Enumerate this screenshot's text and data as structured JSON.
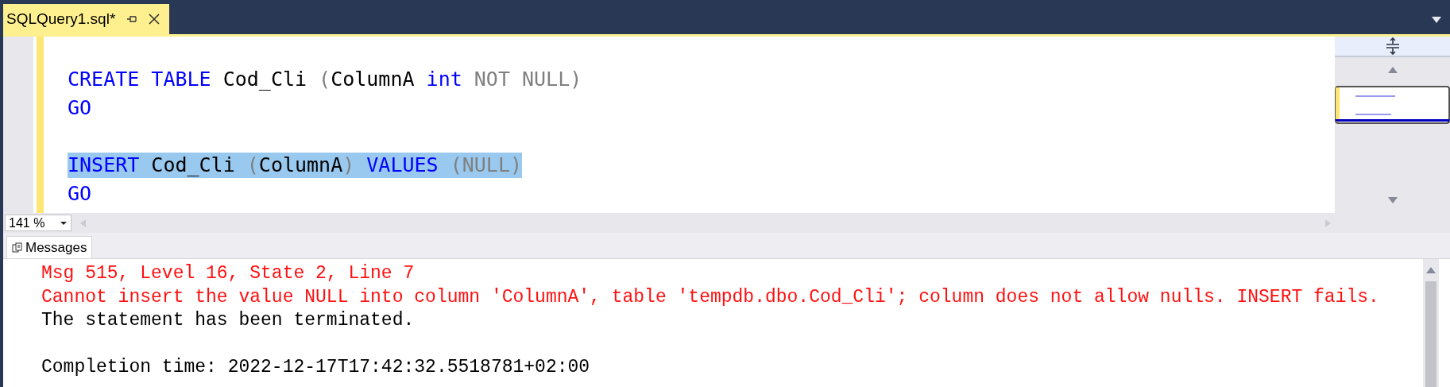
{
  "tab": {
    "title": "SQLQuery1.sql*",
    "selected": true
  },
  "editor": {
    "lines": [
      {
        "kind": "blank",
        "selected": false
      },
      {
        "kind": "code",
        "selected": false,
        "tokens": [
          {
            "kind": "keyword",
            "text": "CREATE TABLE"
          },
          {
            "kind": "plain",
            "text": " Cod_Cli "
          },
          {
            "kind": "operator",
            "text": "("
          },
          {
            "kind": "plain",
            "text": "ColumnA "
          },
          {
            "kind": "keyword",
            "text": "int"
          },
          {
            "kind": "operator",
            "text": " NOT NULL)"
          }
        ]
      },
      {
        "kind": "code",
        "selected": false,
        "tokens": [
          {
            "kind": "keyword",
            "text": "GO"
          }
        ]
      },
      {
        "kind": "blank",
        "selected": false
      },
      {
        "kind": "code",
        "selected": true,
        "tokens": [
          {
            "kind": "keyword",
            "text": "INSERT"
          },
          {
            "kind": "plain",
            "text": " Cod_Cli "
          },
          {
            "kind": "operator",
            "text": "("
          },
          {
            "kind": "plain",
            "text": "ColumnA"
          },
          {
            "kind": "operator",
            "text": ") "
          },
          {
            "kind": "keyword",
            "text": "VALUES"
          },
          {
            "kind": "operator",
            "text": " (NULL)"
          }
        ]
      },
      {
        "kind": "code",
        "selected": false,
        "tokens": [
          {
            "kind": "keyword",
            "text": "GO"
          }
        ]
      }
    ],
    "zoom": "141 %"
  },
  "results": {
    "tab": "Messages",
    "messages": [
      {
        "kind": "error",
        "text": "Msg 515, Level 16, State 2, Line 7"
      },
      {
        "kind": "error",
        "text": "Cannot insert the value NULL into column 'ColumnA', table 'tempdb.dbo.Cod_Cli'; column does not allow nulls. INSERT fails."
      },
      {
        "kind": "info",
        "text": "The statement has been terminated."
      },
      {
        "kind": "blank"
      },
      {
        "kind": "info",
        "text": "Completion time: 2022-12-17T17:42:32.5518781+02:00"
      }
    ]
  }
}
